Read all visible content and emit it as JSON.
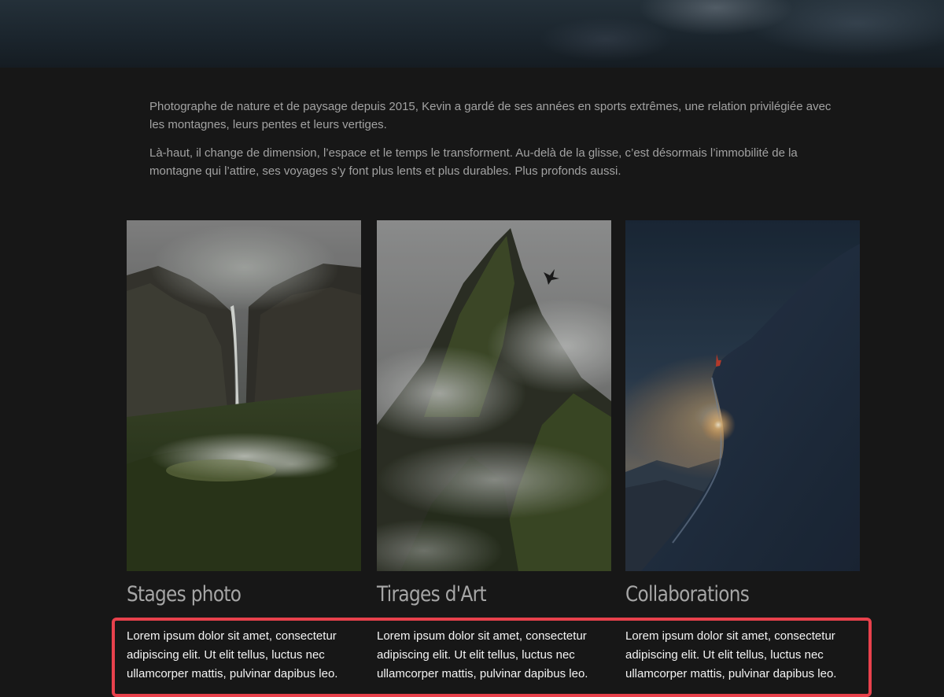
{
  "intro": {
    "paragraph_1": "Photographe de nature et de paysage depuis 2015, Kevin a gardé de ses années en sports extrêmes, une relation privilégiée avec les montagnes, leurs pentes et leurs vertiges.",
    "paragraph_2": "Là-haut, il change de dimension, l’espace et le temps le transforment. Au-delà de la glisse, c’est désormais l’immobilité de la montagne qui l’attire, ses voyages s’y font plus lents et plus durables. Plus profonds aussi."
  },
  "cards": [
    {
      "title": "Stages photo",
      "text": "Lorem ipsum dolor sit amet, consectetur adipiscing elit. Ut elit tellus, luctus nec ullamcorper mattis, pulvinar dapibus leo."
    },
    {
      "title": "Tirages d'Art",
      "text": "Lorem ipsum dolor sit amet, consectetur adipiscing elit. Ut elit tellus, luctus nec ullamcorper mattis, pulvinar dapibus leo."
    },
    {
      "title": "Collaborations",
      "text": "Lorem ipsum dolor sit amet, consectetur adipiscing elit. Ut elit tellus, luctus nec ullamcorper mattis, pulvinar dapibus leo."
    }
  ],
  "colors": {
    "background": "#171717",
    "title": "#a6a6a6",
    "body_text": "#f4f4f4",
    "intro_text": "#a2a2a2",
    "highlight_border": "#e8414c"
  }
}
